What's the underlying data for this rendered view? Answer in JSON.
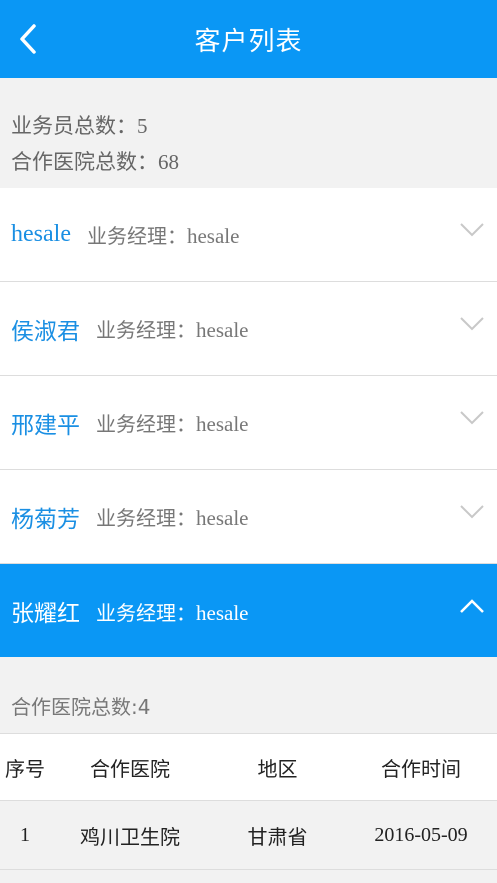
{
  "header": {
    "title": "客户列表"
  },
  "summary": {
    "salesperson_label": "业务员总数：",
    "salesperson_count": "5",
    "hospital_label": "合作医院总数：",
    "hospital_count": "68"
  },
  "list": [
    {
      "name": "hesale",
      "manager_label": "业务经理：",
      "manager": "hesale",
      "expanded": false
    },
    {
      "name": "侯淑君",
      "manager_label": "业务经理：",
      "manager": "hesale",
      "expanded": false
    },
    {
      "name": "邢建平",
      "manager_label": "业务经理：",
      "manager": "hesale",
      "expanded": false
    },
    {
      "name": "杨菊芳",
      "manager_label": "业务经理：",
      "manager": "hesale",
      "expanded": false
    },
    {
      "name": "张耀红",
      "manager_label": "业务经理：",
      "manager": "hesale",
      "expanded": true
    }
  ],
  "detail": {
    "count_text": "合作医院总数:4",
    "columns": [
      "序号",
      "合作医院",
      "地区",
      "合作时间"
    ],
    "rows": [
      [
        "1",
        "鸡川卫生院",
        "甘肃省",
        "2016-05-09"
      ]
    ]
  },
  "colors": {
    "accent": "#0a97f5",
    "link": "#1a8fe3",
    "background": "#f2f2f2"
  },
  "icons": {
    "back": "chevron-left-icon",
    "collapsed": "chevron-down-icon",
    "expanded": "chevron-up-icon"
  }
}
